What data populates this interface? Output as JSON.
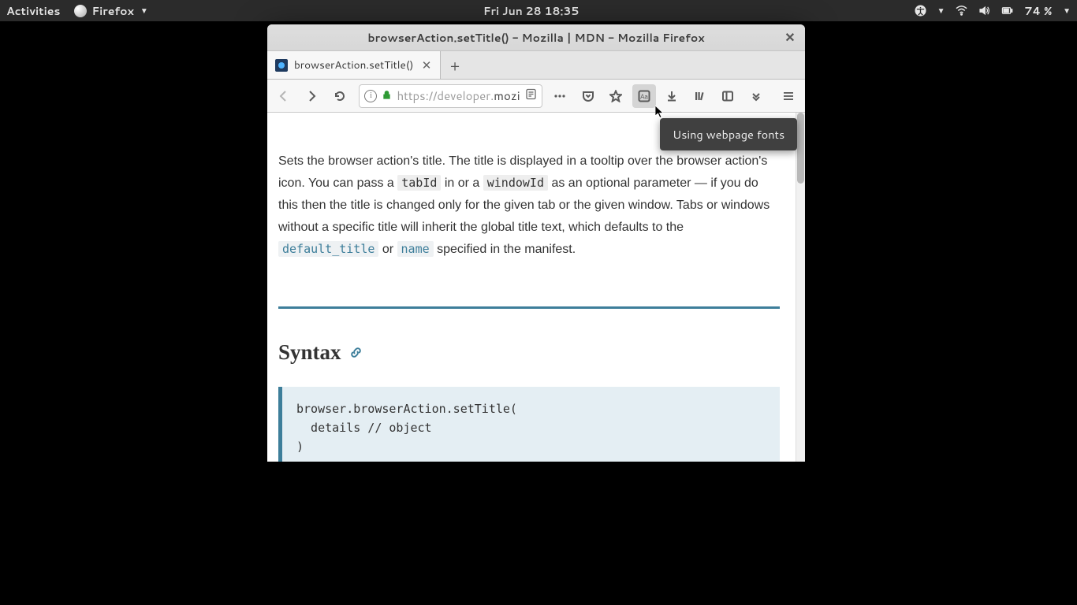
{
  "topbar": {
    "activities": "Activities",
    "app_name": "Firefox",
    "clock": "Fri Jun 28  18:35",
    "battery": "74 %"
  },
  "window": {
    "title": "browserAction.setTitle() - Mozilla | MDN - Mozilla Firefox"
  },
  "tab": {
    "label": "browserAction.setTitle()"
  },
  "url": {
    "scheme": "https://",
    "host_dim_pre": "developer.",
    "host_main": "mozi"
  },
  "tooltip": {
    "text": "Using webpage fonts"
  },
  "article": {
    "p1_a": "Sets the browser action's title. The title is displayed in a tooltip over the browser action's icon. You can pass a ",
    "code_tabId": "tabId",
    "p1_b": " in or a ",
    "code_windowId": "windowId",
    "p1_c": " as an optional parameter — if you do this then the title is changed only for the given tab or the given window. Tabs or windows without a specific title will inherit the global title text, which defaults to the ",
    "code_default_title": "default_title",
    "p1_d": " or ",
    "code_name": "name",
    "p1_e": " specified in the manifest.",
    "syntax_heading": "Syntax",
    "codeblock": "browser.browserAction.setTitle(\n  details // object\n)"
  }
}
